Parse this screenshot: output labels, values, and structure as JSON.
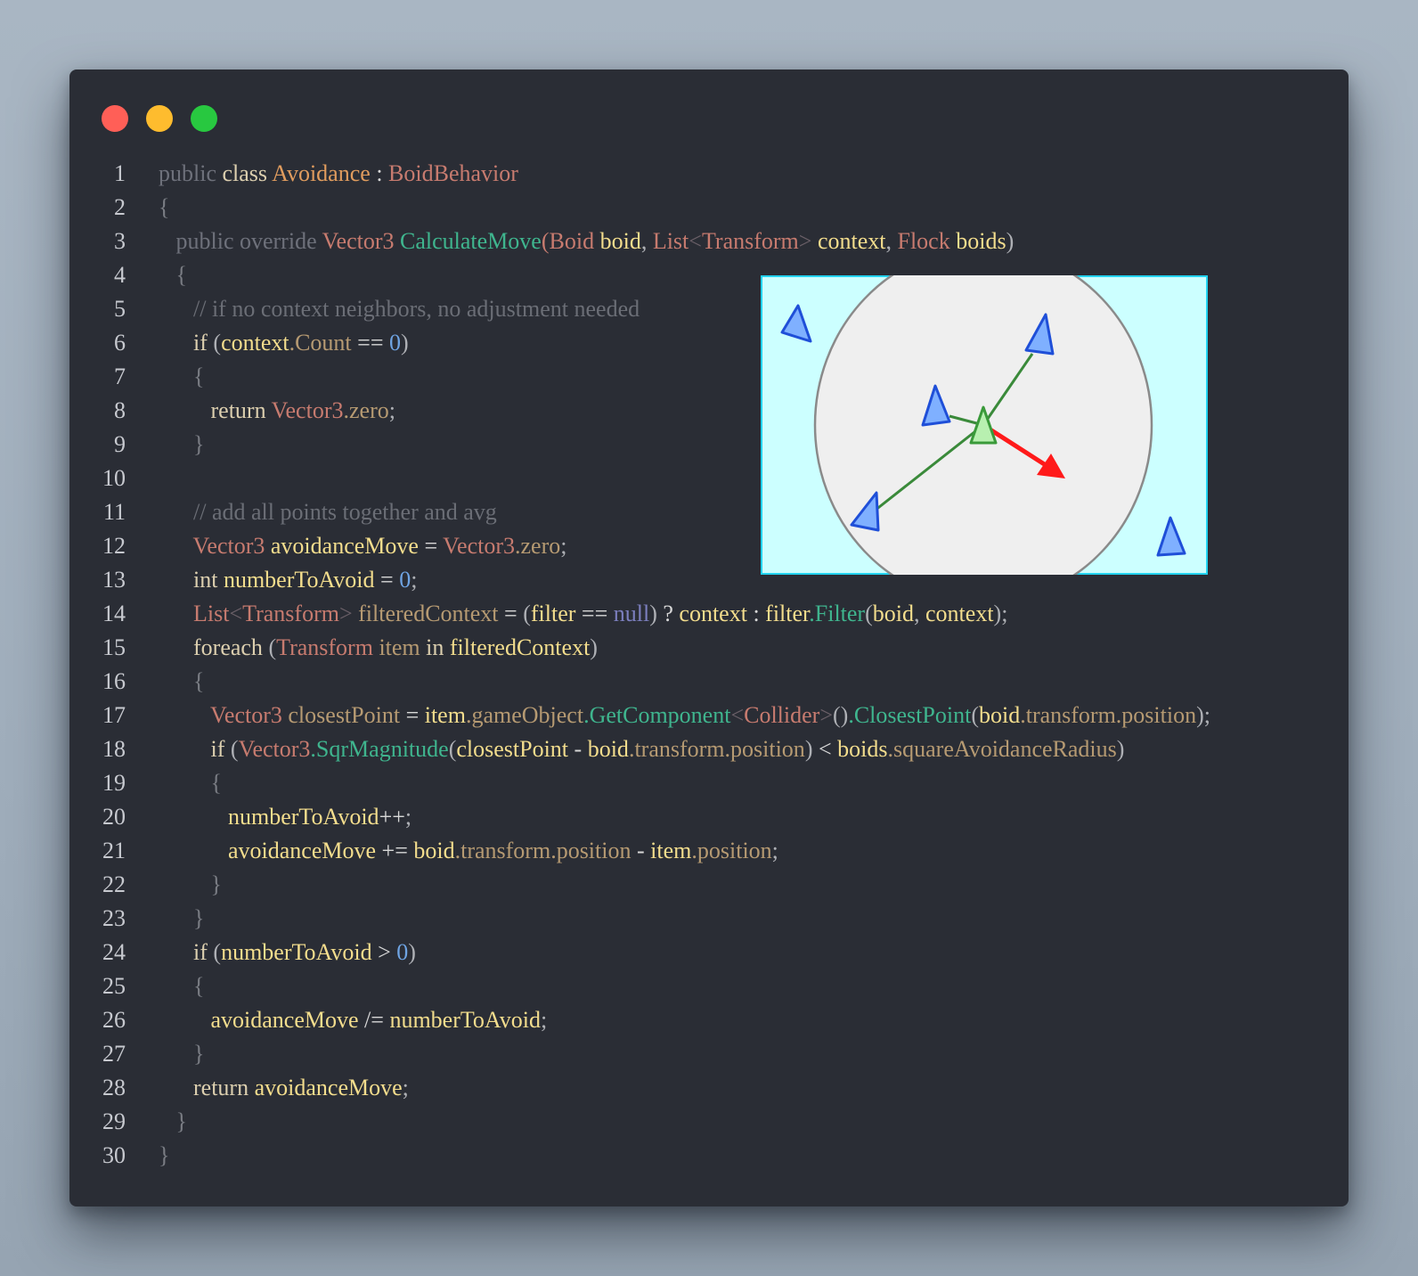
{
  "window": {
    "controls": [
      "close-button",
      "minimize-button",
      "maximize-button"
    ],
    "colors": {
      "background": "#2a2d35",
      "close": "#ff5f57",
      "minimize": "#febc2e",
      "maximize": "#28c840"
    }
  },
  "diagram": {
    "description_icon": "boid-avoidance-illustration",
    "colors": {
      "background": "#ccffff",
      "border": "#22d3f0",
      "circle": "#efefef",
      "boid": "#4f8ef7",
      "center_boid": "#b8f0b0",
      "line": "#3a8a3a",
      "arrow": "#ff1a1a"
    }
  },
  "code": {
    "lines": [
      {
        "n": "1",
        "t": [
          [
            "kw",
            "public "
          ],
          [
            "kw2",
            "class "
          ],
          [
            "cls",
            "Avoidance"
          ],
          [
            "op",
            " : "
          ],
          [
            "ty",
            "BoidBehavior"
          ]
        ]
      },
      {
        "n": "2",
        "t": [
          [
            "br",
            "{"
          ]
        ]
      },
      {
        "n": "3",
        "t": [
          [
            "kw",
            "   public override "
          ],
          [
            "ty",
            "Vector3 "
          ],
          [
            "fn",
            "CalculateMove"
          ],
          [
            "ty",
            "("
          ],
          [
            "ty",
            "Boid "
          ],
          [
            "id",
            "boid"
          ],
          [
            "pn",
            ", "
          ],
          [
            "ty",
            "List"
          ],
          [
            "ag",
            "<"
          ],
          [
            "ty",
            "Transform"
          ],
          [
            "ag",
            "> "
          ],
          [
            "id",
            "context"
          ],
          [
            "pn",
            ", "
          ],
          [
            "ty",
            "Flock "
          ],
          [
            "id",
            "boids"
          ],
          [
            "pn",
            ")"
          ]
        ]
      },
      {
        "n": "4",
        "t": [
          [
            "br",
            "   {"
          ]
        ]
      },
      {
        "n": "5",
        "t": [
          [
            "cm",
            "      // if no context neighbors, no adjustment needed"
          ]
        ]
      },
      {
        "n": "6",
        "t": [
          [
            "kw2",
            "      if "
          ],
          [
            "pn",
            "("
          ],
          [
            "id",
            "context"
          ],
          [
            "mem",
            ".Count "
          ],
          [
            "op",
            "== "
          ],
          [
            "num",
            "0"
          ],
          [
            "pn",
            ")"
          ]
        ]
      },
      {
        "n": "7",
        "t": [
          [
            "br",
            "      {"
          ]
        ]
      },
      {
        "n": "8",
        "t": [
          [
            "kw2",
            "         return "
          ],
          [
            "ty",
            "Vector3"
          ],
          [
            "mem",
            ".zero"
          ],
          [
            "pn",
            ";"
          ]
        ]
      },
      {
        "n": "9",
        "t": [
          [
            "br",
            "      }"
          ]
        ]
      },
      {
        "n": "10",
        "t": []
      },
      {
        "n": "11",
        "t": [
          [
            "cm",
            "      // add all points together and avg"
          ]
        ]
      },
      {
        "n": "12",
        "t": [
          [
            "ty",
            "      Vector3 "
          ],
          [
            "id",
            "avoidanceMove "
          ],
          [
            "op",
            "= "
          ],
          [
            "ty",
            "Vector3"
          ],
          [
            "mem",
            ".zero"
          ],
          [
            "pn",
            ";"
          ]
        ]
      },
      {
        "n": "13",
        "t": [
          [
            "kw2",
            "      int "
          ],
          [
            "id",
            "numberToAvoid "
          ],
          [
            "op",
            "= "
          ],
          [
            "num",
            "0"
          ],
          [
            "pn",
            ";"
          ]
        ]
      },
      {
        "n": "14",
        "t": [
          [
            "ty",
            "      List"
          ],
          [
            "ag",
            "<"
          ],
          [
            "ty",
            "Transform"
          ],
          [
            "ag",
            "> "
          ],
          [
            "mem",
            "filteredContext "
          ],
          [
            "op",
            "= "
          ],
          [
            "pn",
            "("
          ],
          [
            "id",
            "filter "
          ],
          [
            "op",
            "== "
          ],
          [
            "nul",
            "null"
          ],
          [
            "pn",
            ") "
          ],
          [
            "op",
            "? "
          ],
          [
            "id",
            "context "
          ],
          [
            "op",
            ": "
          ],
          [
            "id",
            "filter"
          ],
          [
            "fn",
            ".Filter"
          ],
          [
            "pn",
            "("
          ],
          [
            "id",
            "boid"
          ],
          [
            "pn",
            ", "
          ],
          [
            "id",
            "context"
          ],
          [
            "pn",
            ");"
          ]
        ]
      },
      {
        "n": "15",
        "t": [
          [
            "kw2",
            "      foreach "
          ],
          [
            "pn",
            "("
          ],
          [
            "ty",
            "Transform "
          ],
          [
            "mem",
            "item "
          ],
          [
            "kw2",
            "in "
          ],
          [
            "id",
            "filteredContext"
          ],
          [
            "pn",
            ")"
          ]
        ]
      },
      {
        "n": "16",
        "t": [
          [
            "br",
            "      {"
          ]
        ]
      },
      {
        "n": "17",
        "t": [
          [
            "ty",
            "         Vector3 "
          ],
          [
            "mem",
            "closestPoint "
          ],
          [
            "op",
            "= "
          ],
          [
            "id",
            "item"
          ],
          [
            "mem",
            ".gameObject"
          ],
          [
            "fn",
            ".GetComponent"
          ],
          [
            "ag",
            "<"
          ],
          [
            "ty",
            "Collider"
          ],
          [
            "ag",
            ">"
          ],
          [
            "pn",
            "()"
          ],
          [
            "fn",
            ".ClosestPoint"
          ],
          [
            "pn",
            "("
          ],
          [
            "id",
            "boid"
          ],
          [
            "mem",
            ".transform.position"
          ],
          [
            "pn",
            ");"
          ]
        ]
      },
      {
        "n": "18",
        "t": [
          [
            "kw2",
            "         if "
          ],
          [
            "pn",
            "("
          ],
          [
            "ty",
            "Vector3"
          ],
          [
            "fn",
            ".SqrMagnitude"
          ],
          [
            "pn",
            "("
          ],
          [
            "id",
            "closestPoint "
          ],
          [
            "op",
            "- "
          ],
          [
            "id",
            "boid"
          ],
          [
            "mem",
            ".transform.position"
          ],
          [
            "pn",
            ") "
          ],
          [
            "op",
            "< "
          ],
          [
            "id",
            "boids"
          ],
          [
            "mem",
            ".squareAvoidanceRadius"
          ],
          [
            "pn",
            ")"
          ]
        ]
      },
      {
        "n": "19",
        "t": [
          [
            "br",
            "         {"
          ]
        ]
      },
      {
        "n": "20",
        "t": [
          [
            "id",
            "            numberToAvoid"
          ],
          [
            "op",
            "++"
          ],
          [
            "pn",
            ";"
          ]
        ]
      },
      {
        "n": "21",
        "t": [
          [
            "id",
            "            avoidanceMove "
          ],
          [
            "op",
            "+= "
          ],
          [
            "id",
            "boid"
          ],
          [
            "mem",
            ".transform.position "
          ],
          [
            "op",
            "- "
          ],
          [
            "id",
            "item"
          ],
          [
            "mem",
            ".position"
          ],
          [
            "pn",
            ";"
          ]
        ]
      },
      {
        "n": "22",
        "t": [
          [
            "br",
            "         }"
          ]
        ]
      },
      {
        "n": "23",
        "t": [
          [
            "br",
            "      }"
          ]
        ]
      },
      {
        "n": "24",
        "t": [
          [
            "kw2",
            "      if "
          ],
          [
            "pn",
            "("
          ],
          [
            "id",
            "numberToAvoid "
          ],
          [
            "op",
            "> "
          ],
          [
            "num",
            "0"
          ],
          [
            "pn",
            ")"
          ]
        ]
      },
      {
        "n": "25",
        "t": [
          [
            "br",
            "      {"
          ]
        ]
      },
      {
        "n": "26",
        "t": [
          [
            "id",
            "         avoidanceMove "
          ],
          [
            "op",
            "/= "
          ],
          [
            "id",
            "numberToAvoid"
          ],
          [
            "pn",
            ";"
          ]
        ]
      },
      {
        "n": "27",
        "t": [
          [
            "br",
            "      }"
          ]
        ]
      },
      {
        "n": "28",
        "t": [
          [
            "kw2",
            "      return "
          ],
          [
            "id",
            "avoidanceMove"
          ],
          [
            "pn",
            ";"
          ]
        ]
      },
      {
        "n": "29",
        "t": [
          [
            "br",
            "   }"
          ]
        ]
      },
      {
        "n": "30",
        "t": [
          [
            "br",
            "}"
          ]
        ]
      }
    ]
  }
}
